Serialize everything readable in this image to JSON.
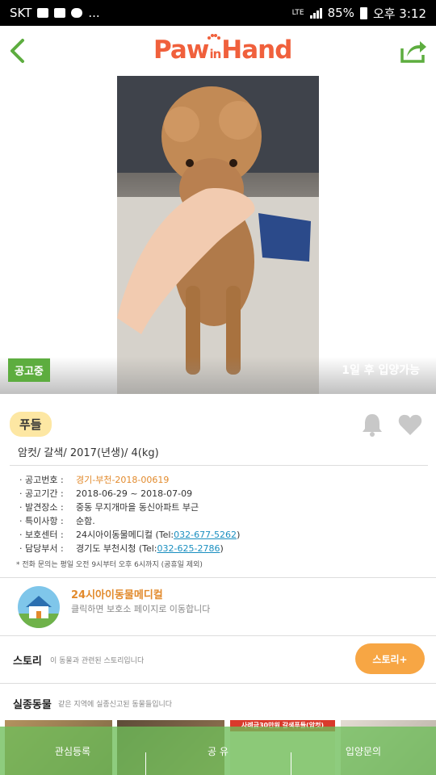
{
  "status_bar": {
    "carrier": "SKT",
    "ellipsis": "...",
    "network": "LTE",
    "battery": "85%",
    "time": "오후 3:12"
  },
  "header": {
    "logo_text_1": "Paw",
    "logo_text_in": "in",
    "logo_text_2": "Hand"
  },
  "photo": {
    "status_badge": "공고중",
    "adoption_note": "1일 후 입양가능"
  },
  "animal": {
    "breed": "푸들",
    "summary": "암컷/ 갈색/ 2017(년생)/ 4(kg)"
  },
  "details": {
    "notice_number_label": "· 공고번호 :",
    "notice_number": "경기-부천-2018-00619",
    "notice_period_label": "· 공고기간 :",
    "notice_period": "2018-06-29 ~ 2018-07-09",
    "found_place_label": "· 발견장소 :",
    "found_place": "중동 무지개마을 동신아파트 부근",
    "notes_label": "· 특이사항 :",
    "notes": "순함.",
    "shelter_label": "· 보호센터 :",
    "shelter": "24시아이동물메디컬 (Tel: ",
    "shelter_tel": "032-677-5262",
    "shelter_close": ")",
    "dept_label": "· 담당부서 :",
    "dept": "경기도 부천시청 (Tel: ",
    "dept_tel": "032-625-2786",
    "dept_close": ")",
    "call_notice": "* 전화 문의는 평일 오전 9시부터 오후 6시까지 (공휴일 제외)"
  },
  "shelter_card": {
    "name": "24시아이동물메디컬",
    "description": "클릭하면 보호소 페이지로 이동합니다"
  },
  "story": {
    "title": "스토리",
    "description": "이 동물과 관련된 스토리입니다",
    "button": "스토리+"
  },
  "missing": {
    "title": "실종동물",
    "description": "같은 지역에 실종신고된 동물들입니다",
    "thumb3_banner": "사례금30만원 갈색푸들(암컷)"
  },
  "bottom_nav": {
    "items": [
      "관심등록",
      "공 유",
      "입양문의"
    ]
  },
  "colors": {
    "brand_orange": "#f0603c",
    "nav_green": "#6ebe5a",
    "status_green": "#5dad3f",
    "story_orange": "#f7a644",
    "link_blue": "#1a8fc0"
  }
}
